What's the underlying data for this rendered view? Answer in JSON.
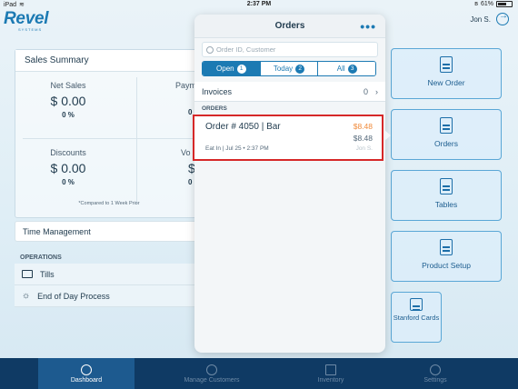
{
  "status_bar": {
    "device": "iPad",
    "time": "2:37 PM",
    "battery": "61%"
  },
  "header": {
    "logo": "Revel",
    "logo_sub": "SYSTEMS",
    "user": "Jon S."
  },
  "sales_summary": {
    "title": "Sales Summary",
    "metrics": [
      {
        "label": "Net Sales",
        "value": "$ 0.00",
        "percent": "0 %"
      },
      {
        "label": "Paym",
        "value": "",
        "percent": "0"
      },
      {
        "label": "Discounts",
        "value": "$ 0.00",
        "percent": "0 %"
      },
      {
        "label": "Vo",
        "value": "$",
        "percent": "0"
      }
    ],
    "note": "*Compared to 1 Week Prior"
  },
  "time_management": "Time Management",
  "operations": {
    "label": "OPERATIONS",
    "items": [
      "Tills",
      "End of Day Process"
    ]
  },
  "tiles": [
    "New Order",
    "Orders",
    "Tables",
    "Product Setup",
    "Stanford Cards"
  ],
  "orders_popover": {
    "title": "Orders",
    "search_placeholder": "Order ID, Customer",
    "segments": [
      {
        "label": "Open",
        "count": "1"
      },
      {
        "label": "Today",
        "count": "2"
      },
      {
        "label": "All",
        "count": "3"
      }
    ],
    "invoices_label": "Invoices",
    "invoices_count": "0",
    "section_label": "ORDERS",
    "order": {
      "title": "Order # 4050 | Bar",
      "amount_due": "$8.48",
      "amount_total": "$8.48",
      "meta": "Eat In | Jul 25 • 2:37 PM",
      "user": "Jon S."
    }
  },
  "tabbar": [
    "Dashboard",
    "Manage Customers",
    "Inventory",
    "Settings"
  ],
  "colors": {
    "accent": "#1c7ab3",
    "tabbar": "#0f3a64",
    "highlight": "#d62828",
    "amount": "#f08a3a"
  }
}
